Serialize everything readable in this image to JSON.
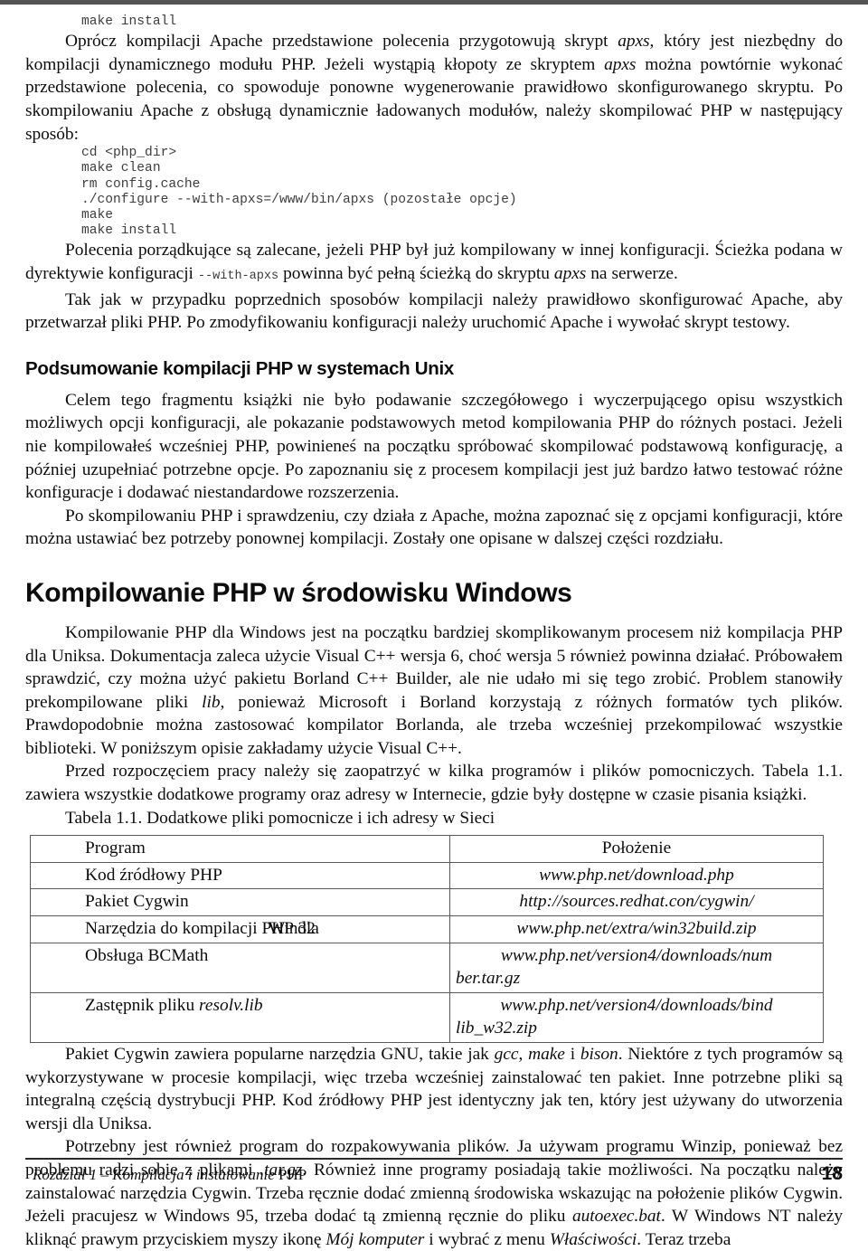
{
  "page": {
    "number": "18",
    "footer_text_italic": "Rozdział 1 – Kompilacja i instalowanie ",
    "footer_text_roman": "PHP"
  },
  "code_top": {
    "line1": "make install"
  },
  "paragraphs": {
    "p1_a": "Oprócz kompilacji Apache przedstawione polecenia przygotowują skrypt ",
    "p1_apxs1": "apxs",
    "p1_b": ", który jest niezbędny do kompilacji dynamicznego modułu PHP. Jeżeli wystąpią kłopoty ze skryptem ",
    "p1_apxs2": "apxs",
    "p1_c": " można powtórnie wykonać przedstawione polecenia, co spowoduje ponowne wygenerowanie prawidłowo skonfigurowanego skryptu. Po skompilowaniu Apache z obsługą dynamicznie ładowanych modułów, należy skompilować PHP w następujący sposób:",
    "p2_a": "Polecenia porządkujące są zalecane, jeżeli PHP był już kompilowany w innej konfiguracji. Ścieżka podana w dyrektywie konfiguracji ",
    "p2_code": "--with-apxs",
    "p2_b": " powinna być pełną ścieżką do skryptu ",
    "p2_apxs": "apxs",
    "p2_c": " na serwerze.",
    "p3": "Tak jak w przypadku poprzednich sposobów kompilacji należy prawidłowo skonfigurować Apache, aby przetwarzał pliki PHP. Po zmodyfikowaniu konfiguracji należy uruchomić Apache i wywołać skrypt testowy.",
    "p4": "Celem tego fragmentu książki nie było podawanie szczegółowego i wyczerpującego opisu wszystkich możliwych opcji konfiguracji, ale pokazanie podstawowych metod kompilowania PHP do różnych postaci. Jeżeli nie kompilowałeś wcześniej PHP, powinieneś na początku spróbować skompilować podstawową konfigurację, a później uzupełniać potrzebne opcje. Po zapoznaniu się z procesem kompilacji jest już bardzo łatwo testować różne konfiguracje i dodawać niestandardowe rozszerzenia.",
    "p5": "Po skompilowaniu PHP i sprawdzeniu, czy działa z Apache, można zapoznać się z opcjami konfiguracji, które można ustawiać bez potrzeby ponownej kompilacji. Zostały one opisane w dalszej części rozdziału.",
    "p6_a": "Kompilowanie PHP dla Windows jest na początku bardziej skomplikowanym procesem niż kompilacja PHP dla Uniksa. Dokumentacja zaleca użycie Visual C++ wersja 6, choć wersja 5 również powinna działać. Próbowałem sprawdzić, czy można użyć pakietu Borland C++ Builder, ale nie udało mi się tego zrobić. Problem stanowiły prekompilowane pliki ",
    "p6_lib": "lib",
    "p6_b": ", ponieważ Microsoft i Borland korzystają z różnych formatów tych plików. Prawdopodobnie można zastosować kompilator Borlanda, ale trzeba wcześniej przekompilować wszystkie biblioteki. W poniższym opisie zakładamy użycie Visual C++.",
    "p7": "Przed rozpoczęciem pracy należy się zaopatrzyć w kilka programów i plików pomocniczych. Tabela 1.1. zawiera wszystkie dodatkowe programy oraz adresy w Internecie, gdzie były dostępne w czasie pisania książki.",
    "p8_a": "Pakiet Cygwin zawiera popularne narzędzia GNU, takie jak ",
    "p8_gcc": "gcc",
    "p8_b": ", ",
    "p8_make": "make",
    "p8_c": " i ",
    "p8_bison": "bison",
    "p8_d": ". Niektóre z tych programów są wykorzystywane w procesie kompilacji, więc trzeba wcześniej zainstalować ten pakiet. Inne potrzebne pliki są integralną częścią dystrybucji PHP. Kod źródłowy PHP jest identyczny jak ten, który jest używany do utworzenia wersji dla Uniksa.",
    "p9_a": "Potrzebny jest również program do rozpakowywania plików. Ja używam programu Winzip, ponieważ bez problemu radzi sobie z plikami ",
    "p9_targz": ".tar.gz",
    "p9_b": ". Również inne programy posiadają takie możliwości. Na początku należy zainstalować narzędzia Cygwin. Trzeba ręcznie dodać zmienną środowiska wskazując na położenie plików Cygwin. Jeżeli pracujesz w Windows 95, trzeba dodać tą zmienną ręcznie do pliku ",
    "p9_autoexec": "autoexec.bat",
    "p9_c": ". W Windows NT należy kliknąć prawym przyciskiem myszy ikonę ",
    "p9_mojkomputer": "Mój komputer",
    "p9_d": " i wybrać z menu ",
    "p9_wlasciwosci": "Właściwości",
    "p9_e": ". Teraz trzeba"
  },
  "code_block": {
    "lines": [
      "cd <php_dir>",
      "make clean",
      "rm config.cache",
      "./configure --with-apxs=/www/bin/apxs (pozostałe opcje)",
      "make",
      "make install"
    ],
    "text": "cd <php_dir>\nmake clean\nrm config.cache\n./configure --with-apxs=/www/bin/apxs (pozostałe opcje)\nmake\nmake install"
  },
  "headings": {
    "section_unix": "Podsumowanie kompilacji PHP w systemach Unix",
    "chapter_windows": "Kompilowanie PHP w środowisku Windows"
  },
  "table": {
    "caption": "Tabela 1.1. Dodatkowe pliki pomocnicze i ich adresy w Sieci",
    "headers": [
      "Program",
      "Położenie"
    ],
    "rows": [
      {
        "program": "Kod źródłowy PHP",
        "url": "www.php.net/download.php"
      },
      {
        "program": "Pakiet Cygwin",
        "url": "http://sources.redhat.con/cygwin/"
      },
      {
        "program": "Narzędzia do kompilacji PHP dla",
        "program_overflow": "Win32",
        "url": "www.php.net/extra/win32build.zip"
      },
      {
        "program": "Obsługa BCMath",
        "url": "www.php.net/version4/downloads/num",
        "url_line2": "ber.tar.gz"
      },
      {
        "program": "Zastępnik pliku ",
        "program_italic": "resolv.lib",
        "url": "www.php.net/version4/downloads/bind",
        "url_line2": "lib_w32.zip"
      }
    ]
  },
  "colors": {
    "text": "#0d0d0d",
    "code": "#3e3e3e",
    "rule": "#555555",
    "table_border": "#5a5a5a"
  }
}
